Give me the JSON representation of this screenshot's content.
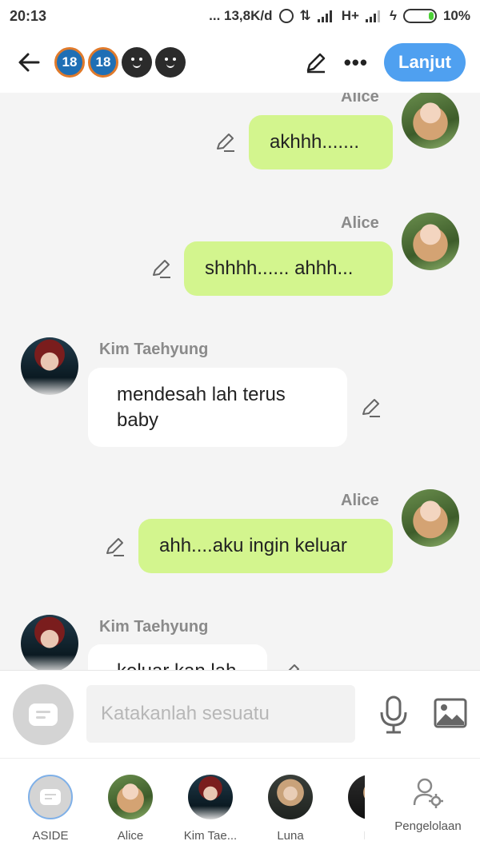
{
  "status_bar": {
    "time": "20:13",
    "speed": "... 13,8K/d",
    "network": "H+",
    "battery": "10%"
  },
  "topbar": {
    "badges": [
      "18",
      "18"
    ],
    "next_label": "Lanjut"
  },
  "messages": [
    {
      "sender": "Alice",
      "text": "akhhh.......",
      "side": "right"
    },
    {
      "sender": "Alice",
      "text": "shhhh...... ahhh...",
      "side": "right"
    },
    {
      "sender": "Kim Taehyung",
      "text": "mendesah lah terus baby",
      "side": "left"
    },
    {
      "sender": "Alice",
      "text": "ahh....aku ingin keluar",
      "side": "right"
    },
    {
      "sender": "Kim Taehyung",
      "text": "keluar kan lah",
      "side": "left"
    }
  ],
  "input": {
    "placeholder": "Katakanlah sesuatu"
  },
  "tabs": [
    {
      "label": "ASIDE"
    },
    {
      "label": "Alice"
    },
    {
      "label": "Kim Tae..."
    },
    {
      "label": "Luna"
    },
    {
      "label": "La"
    }
  ],
  "manage": {
    "label": "Pengelolaan"
  },
  "colors": {
    "accent": "#4fa0f0",
    "my_bubble": "#d3f58e",
    "other_bubble": "#ffffff",
    "background": "#f4f4f4"
  }
}
